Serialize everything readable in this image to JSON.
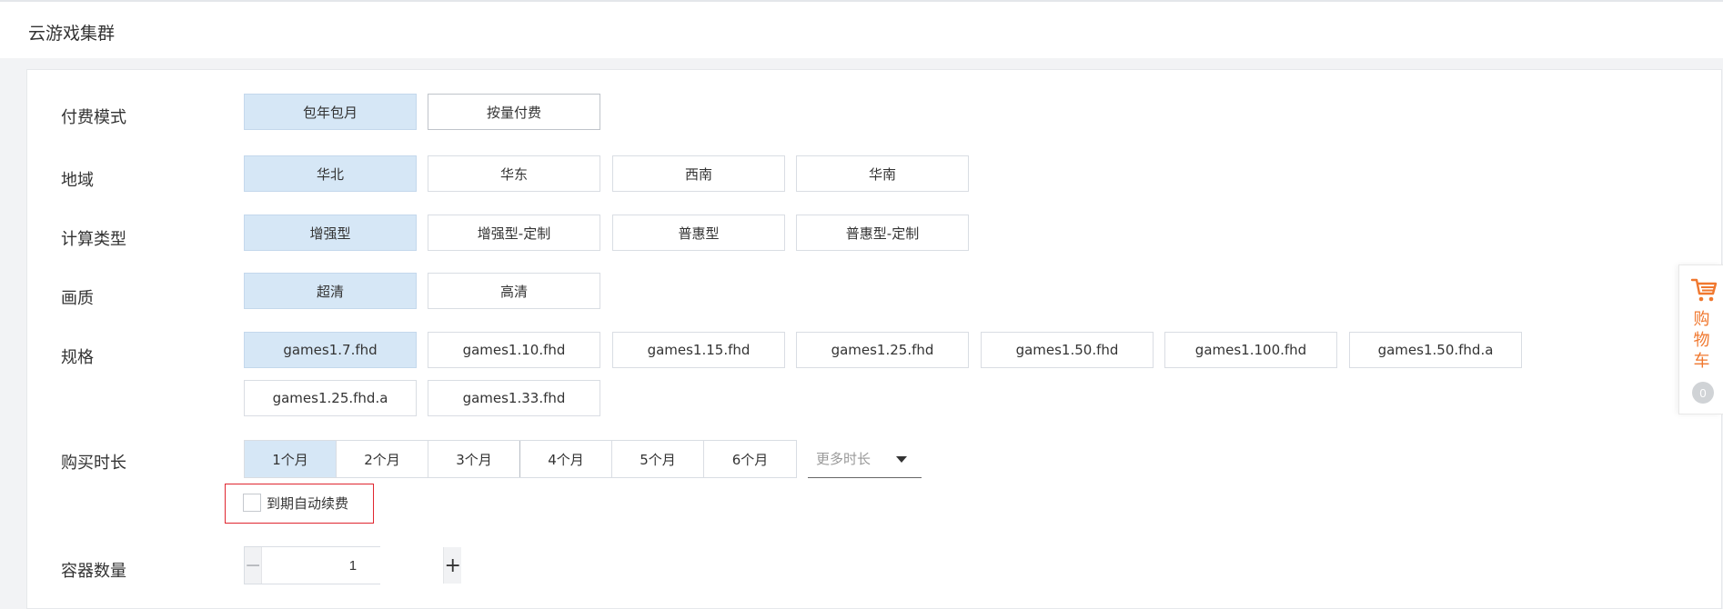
{
  "header": {
    "title": "云游戏集群"
  },
  "billing": {
    "label": "付费模式",
    "options": [
      "包年包月",
      "按量付费"
    ],
    "selected": "包年包月"
  },
  "region": {
    "label": "地域",
    "options": [
      "华北",
      "华东",
      "西南",
      "华南"
    ],
    "selected": "华北"
  },
  "compute": {
    "label": "计算类型",
    "options": [
      "增强型",
      "增强型-定制",
      "普惠型",
      "普惠型-定制"
    ],
    "selected": "增强型"
  },
  "quality": {
    "label": "画质",
    "options": [
      "超清",
      "高清"
    ],
    "selected": "超清"
  },
  "spec": {
    "label": "规格",
    "options": [
      "games1.7.fhd",
      "games1.10.fhd",
      "games1.15.fhd",
      "games1.25.fhd",
      "games1.50.fhd",
      "games1.100.fhd",
      "games1.50.fhd.a",
      "games1.25.fhd.a",
      "games1.33.fhd"
    ],
    "selected": "games1.7.fhd"
  },
  "duration": {
    "label": "购买时长",
    "options": [
      "1个月",
      "2个月",
      "3个月",
      "4个月",
      "5个月",
      "6个月"
    ],
    "selected": "1个月",
    "more_placeholder": "更多时长"
  },
  "auto_renew": {
    "label": "到期自动续费",
    "checked": false
  },
  "quantity": {
    "label": "容器数量",
    "value": "1",
    "minus": "−",
    "plus": "+"
  },
  "cart": {
    "label_chars": [
      "购",
      "物",
      "车"
    ],
    "count": "0",
    "accent": "#f0782f"
  },
  "colors": {
    "selected_bg": "#d6e7f6",
    "highlight_border": "#e0262f"
  }
}
